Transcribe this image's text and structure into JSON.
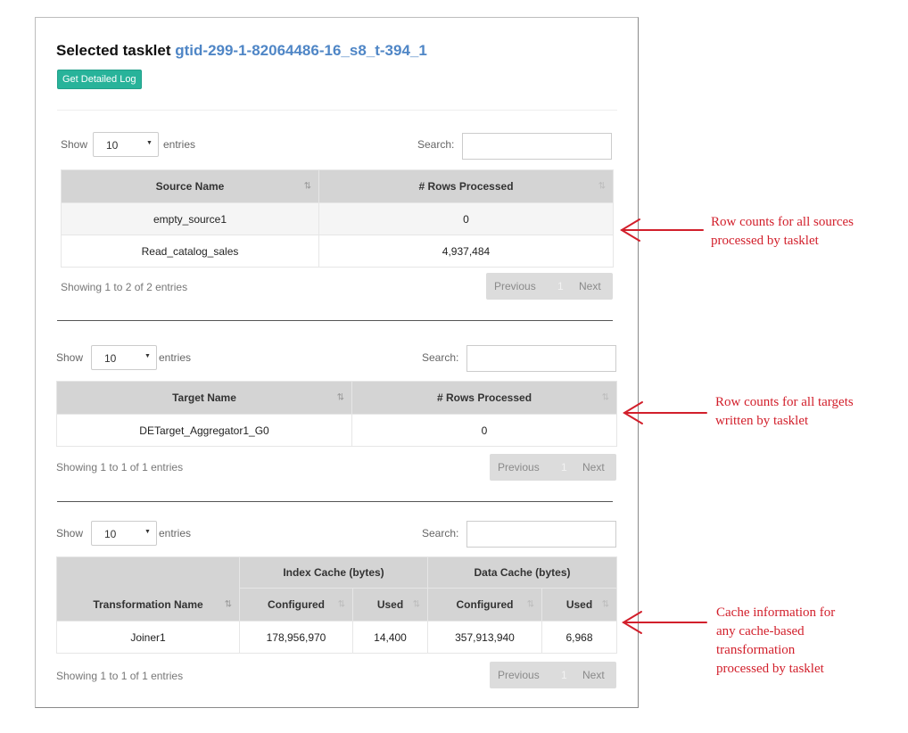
{
  "header": {
    "title_prefix": "Selected tasklet",
    "tasklet_id": "gtid-299-1-82064486-16_s8_t-394_1",
    "log_button": "Get Detailed Log"
  },
  "common": {
    "show_label": "Show",
    "entries_label": "entries",
    "page_length": "10",
    "search_label": "Search:",
    "previous": "Previous",
    "page_number": "1",
    "next": "Next"
  },
  "sources": {
    "columns": [
      "Source Name",
      "# Rows Processed"
    ],
    "rows": [
      [
        "empty_source1",
        "0"
      ],
      [
        "Read_catalog_sales",
        "4,937,484"
      ]
    ],
    "info": "Showing 1 to 2 of 2 entries"
  },
  "targets": {
    "columns": [
      "Target Name",
      "# Rows Processed"
    ],
    "rows": [
      [
        "DETarget_Aggregator1_G0",
        "0"
      ]
    ],
    "info": "Showing 1 to 1 of 1 entries"
  },
  "cache": {
    "group_headers": [
      "Index Cache (bytes)",
      "Data Cache (bytes)"
    ],
    "columns": [
      "Transformation Name",
      "Configured",
      "Used",
      "Configured",
      "Used"
    ],
    "rows": [
      [
        "Joiner1",
        "178,956,970",
        "14,400",
        "357,913,940",
        "6,968"
      ]
    ],
    "info": "Showing 1 to 1 of 1 entries"
  },
  "annotations": {
    "sources": [
      "Row counts for all sources",
      "processed by tasklet"
    ],
    "targets": [
      "Row counts for all targets",
      "written by tasklet"
    ],
    "cache": [
      "Cache information for",
      "any cache-based",
      "transformation",
      "processed by tasklet"
    ]
  },
  "colors": {
    "accent_link": "#4f86c6",
    "button_green": "#28b39a",
    "annotation_red": "#d21f2b",
    "header_gray": "#d4d4d4"
  }
}
